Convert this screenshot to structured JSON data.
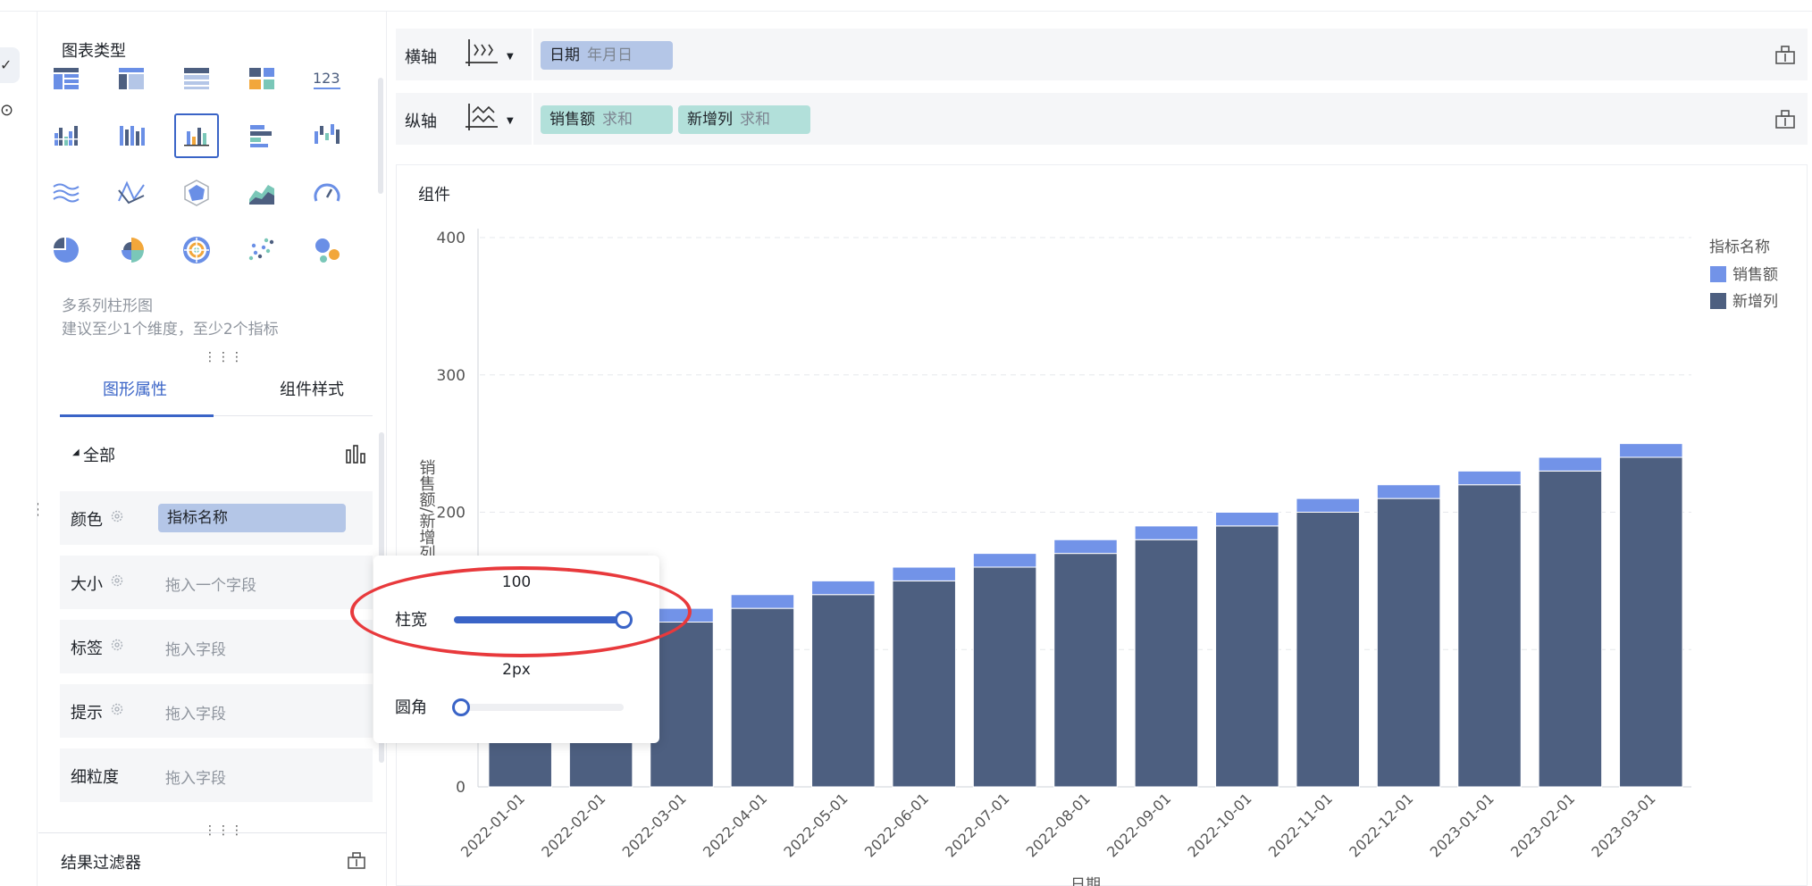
{
  "left_strip": {
    "btn1_icon": "check-icon",
    "btn2_icon": "more-icon"
  },
  "panel": {
    "title": "图表类型",
    "chart_types": [
      {
        "icon": "table-list-icon"
      },
      {
        "icon": "table-cross-icon"
      },
      {
        "icon": "table-detail-icon"
      },
      {
        "icon": "kpi-blocks-icon"
      },
      {
        "icon": "number-123-icon",
        "text": "123"
      },
      {
        "icon": "grouped-bar-icon"
      },
      {
        "icon": "stacked-bar-icon"
      },
      {
        "icon": "multi-series-bar-icon",
        "selected": true
      },
      {
        "icon": "horizontal-bar-icon"
      },
      {
        "icon": "waterfall-icon"
      },
      {
        "icon": "line-icon"
      },
      {
        "icon": "multi-line-icon"
      },
      {
        "icon": "radar-icon"
      },
      {
        "icon": "area-icon"
      },
      {
        "icon": "gauge-icon"
      },
      {
        "icon": "pie-icon"
      },
      {
        "icon": "rose-pie-icon"
      },
      {
        "icon": "sunburst-icon"
      },
      {
        "icon": "scatter-icon"
      },
      {
        "icon": "bubble-icon"
      }
    ],
    "selected_name": "多系列柱形图",
    "selected_hint": "建议至少1个维度，至少2个指标",
    "tabs": [
      {
        "label": "图形属性"
      },
      {
        "label": "组件样式"
      }
    ],
    "section_label": "全部",
    "fields": [
      {
        "name": "颜色",
        "value": "指标名称",
        "placeholder": ""
      },
      {
        "name": "大小",
        "value": "",
        "placeholder": "拖入一个字段"
      },
      {
        "name": "标签",
        "value": "",
        "placeholder": "拖入字段"
      },
      {
        "name": "提示",
        "value": "",
        "placeholder": "拖入字段"
      },
      {
        "name": "细粒度",
        "value": "",
        "placeholder": "拖入字段"
      }
    ],
    "result_filter": "结果过滤器"
  },
  "axes": {
    "x": {
      "label": "横轴",
      "chips": [
        {
          "name": "日期",
          "agg": "年月日",
          "color": "#b4c6e7"
        }
      ]
    },
    "y": {
      "label": "纵轴",
      "chips": [
        {
          "name": "销售额",
          "agg": "求和",
          "color": "#b2e0da"
        },
        {
          "name": "新增列",
          "agg": "求和",
          "color": "#b2e0da"
        }
      ]
    }
  },
  "chart": {
    "title": "组件"
  },
  "popover": {
    "bar_width_label": "柱宽",
    "bar_width_value": "100",
    "bar_width_fraction": 1.0,
    "radius_label": "圆角",
    "radius_value": "2px",
    "radius_fraction": 0.0
  },
  "chart_data": {
    "type": "bar",
    "stacked": true,
    "categories": [
      "2022-01-01",
      "2022-02-01",
      "2022-03-01",
      "2022-04-01",
      "2022-05-01",
      "2022-06-01",
      "2022-07-01",
      "2022-08-01",
      "2022-09-01",
      "2022-10-01",
      "2022-11-01",
      "2022-12-01",
      "2023-01-01",
      "2023-02-01",
      "2023-03-01"
    ],
    "series": [
      {
        "name": "新增列",
        "color": "#4d5f80",
        "values": [
          100,
          110,
          120,
          130,
          140,
          150,
          160,
          170,
          180,
          190,
          200,
          210,
          220,
          230,
          240
        ]
      },
      {
        "name": "销售额",
        "color": "#7293e8",
        "values": [
          10,
          10,
          10,
          10,
          10,
          10,
          10,
          10,
          10,
          10,
          10,
          10,
          10,
          10,
          10
        ]
      }
    ],
    "yticks": [
      "0",
      "100",
      "200",
      "300",
      "400"
    ],
    "ylim": [
      0,
      400
    ],
    "ylabel": "销售额/新增列",
    "xlabel": "日期",
    "legend": {
      "title": "指标名称",
      "position": "top-right",
      "items": [
        {
          "name": "销售额",
          "color": "#7293e8"
        },
        {
          "name": "新增列",
          "color": "#4d5f80"
        }
      ]
    },
    "grid": true
  }
}
